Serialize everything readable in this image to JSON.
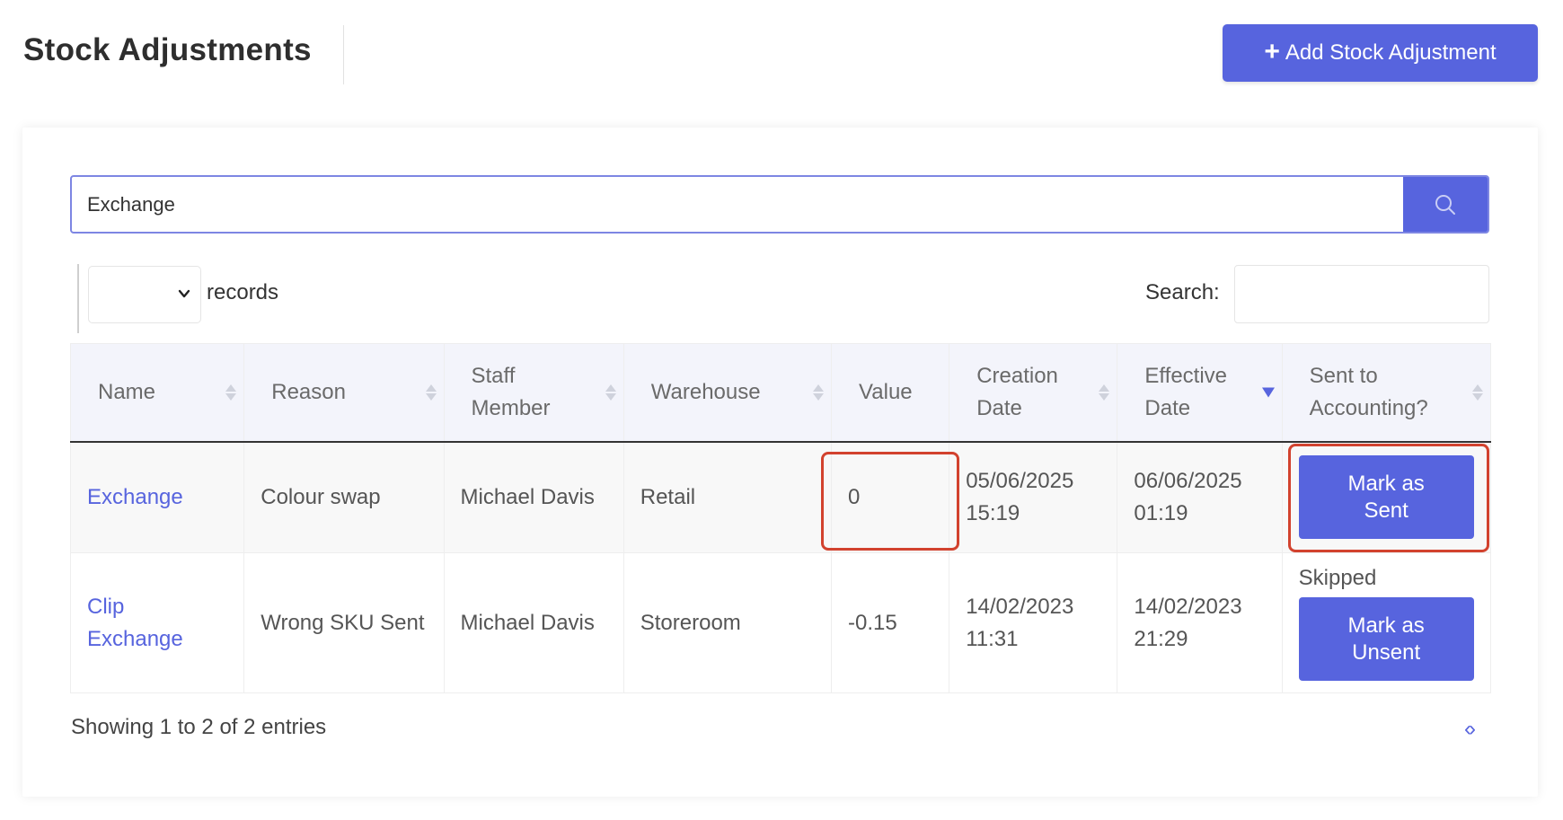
{
  "header": {
    "title": "Stock Adjustments",
    "add_label": "Add Stock Adjustment"
  },
  "filter": {
    "value": "Exchange",
    "search_icon": "search-icon"
  },
  "table_controls": {
    "records_label": "records",
    "records_value": "",
    "search_label": "Search:",
    "search_value": ""
  },
  "table": {
    "columns": [
      "Name",
      "Reason",
      "Staff Member",
      "Warehouse",
      "Value",
      "Creation Date",
      "Effective Date",
      "Sent to Accounting?"
    ],
    "rows": [
      {
        "name_line1": "Exchange",
        "name_line2": "",
        "reason": "Colour swap",
        "staff": "Michael Davis",
        "warehouse": "Retail",
        "value": "0",
        "creation_date": "05/06/2025",
        "creation_time": "15:19",
        "effective_date": "06/06/2025",
        "effective_time": "01:19",
        "status": "",
        "action_line1": "Mark as",
        "action_line2": "Sent"
      },
      {
        "name_line1": "Clip",
        "name_line2": "Exchange",
        "reason": "Wrong SKU Sent",
        "staff": "Michael Davis",
        "warehouse": "Storeroom",
        "value": "-0.15",
        "creation_date": "14/02/2023",
        "creation_time": "11:31",
        "effective_date": "14/02/2023",
        "effective_time": "21:29",
        "status": "Skipped",
        "action_line1": "Mark as",
        "action_line2": "Unsent"
      }
    ]
  },
  "footer": {
    "info": "Showing 1 to 2 of 2 entries"
  },
  "colors": {
    "accent": "#5764de",
    "highlight": "#d2422e",
    "header_bg": "#f3f4fb"
  }
}
